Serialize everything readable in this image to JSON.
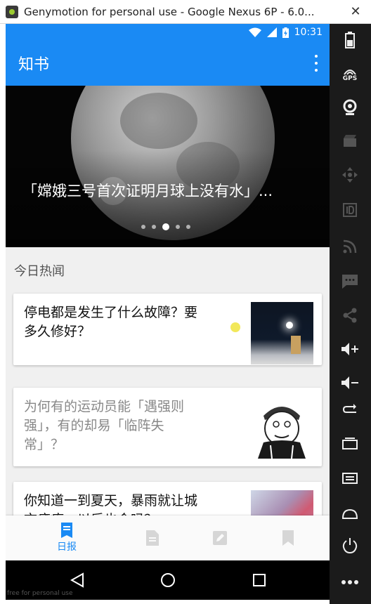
{
  "window": {
    "title": "Genymotion for personal use - Google Nexus 6P - 6.0...",
    "close_symbol": "✕"
  },
  "status_bar": {
    "time": "10:31",
    "icons": [
      "wifi-icon",
      "signal-icon",
      "battery-charging-icon"
    ]
  },
  "app_bar": {
    "title": "知书"
  },
  "banner": {
    "title": "「嫦娥三号首次证明月球上没有水」...",
    "page_count": 5,
    "active_index": 2
  },
  "section": {
    "title": "今日热闻"
  },
  "stories": [
    {
      "title": "停电都是发生了什么故障？要多久修好？",
      "read": false
    },
    {
      "title": "为何有的运动员能「遇强则强」，有的却易「临阵失常」？",
      "read": true
    },
    {
      "title": "你知道一到夏天，暴雨就让城市瘫痪，以后也会吗？",
      "read": false
    }
  ],
  "bottom_nav": {
    "items": [
      {
        "label": "日报",
        "icon": "daily-news-icon",
        "active": true
      },
      {
        "label": "",
        "icon": "document-icon",
        "active": false
      },
      {
        "label": "",
        "icon": "edit-icon",
        "active": false
      },
      {
        "label": "",
        "icon": "bookmark-icon",
        "active": false
      }
    ]
  },
  "system_nav": {
    "icons": [
      "back-icon",
      "home-icon",
      "recents-icon"
    ]
  },
  "side_panel": {
    "icons": [
      "battery-icon",
      "gps-icon",
      "webcam-icon",
      "capture-icon",
      "dpad-icon",
      "identifiers-icon",
      "rss-icon",
      "sms-icon",
      "share-icon",
      "volume-up-icon",
      "volume-down-icon",
      "rotate-icon",
      "recent-apps-icon",
      "menu-icon",
      "home-icon",
      "power-icon",
      "more-icon"
    ],
    "gps_label": "GPS"
  },
  "watermark": "free for personal use",
  "colors": {
    "primary": "#1a8af4",
    "panel": "#1b1b1b"
  }
}
